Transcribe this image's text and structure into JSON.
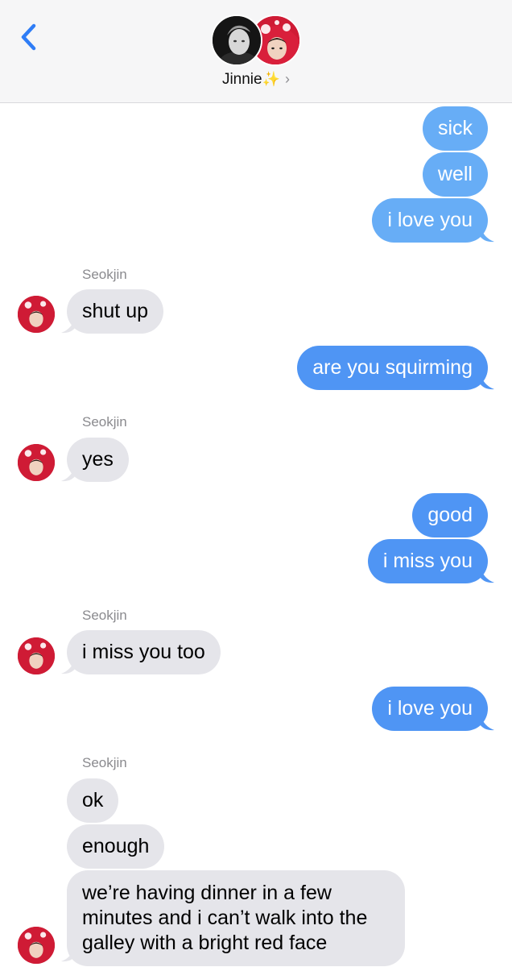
{
  "header": {
    "contact_name": "Jinnie",
    "sparkle": "✨",
    "chevron": "›"
  },
  "icons": {
    "back": "chevron-left-icon",
    "contact_avatar_1": "bw-portrait-avatar",
    "contact_avatar_2": "red-hat-portrait-avatar"
  },
  "colors": {
    "sent_bubble": "#4f95f4",
    "sent_bubble_light": "#67adf6",
    "received_bubble": "#e5e5ea",
    "accent": "#2f7df6"
  },
  "messages": [
    {
      "from": "me",
      "text": "sick"
    },
    {
      "from": "me",
      "text": "well"
    },
    {
      "from": "me",
      "text": "i love you"
    },
    {
      "from": "Seokjin",
      "sender_label": "Seokjin",
      "text": "shut up"
    },
    {
      "from": "me",
      "text": "are you squirming"
    },
    {
      "from": "Seokjin",
      "sender_label": "Seokjin",
      "text": "yes"
    },
    {
      "from": "me",
      "text": "good"
    },
    {
      "from": "me",
      "text": "i miss you"
    },
    {
      "from": "Seokjin",
      "sender_label": "Seokjin",
      "text": "i miss you too"
    },
    {
      "from": "me",
      "text": "i love you"
    },
    {
      "from": "Seokjin",
      "sender_label": "Seokjin",
      "text": "ok"
    },
    {
      "from": "Seokjin",
      "text": "enough"
    },
    {
      "from": "Seokjin",
      "text": "we’re having dinner in a few minutes and i can’t walk into the galley with a bright red face"
    }
  ]
}
